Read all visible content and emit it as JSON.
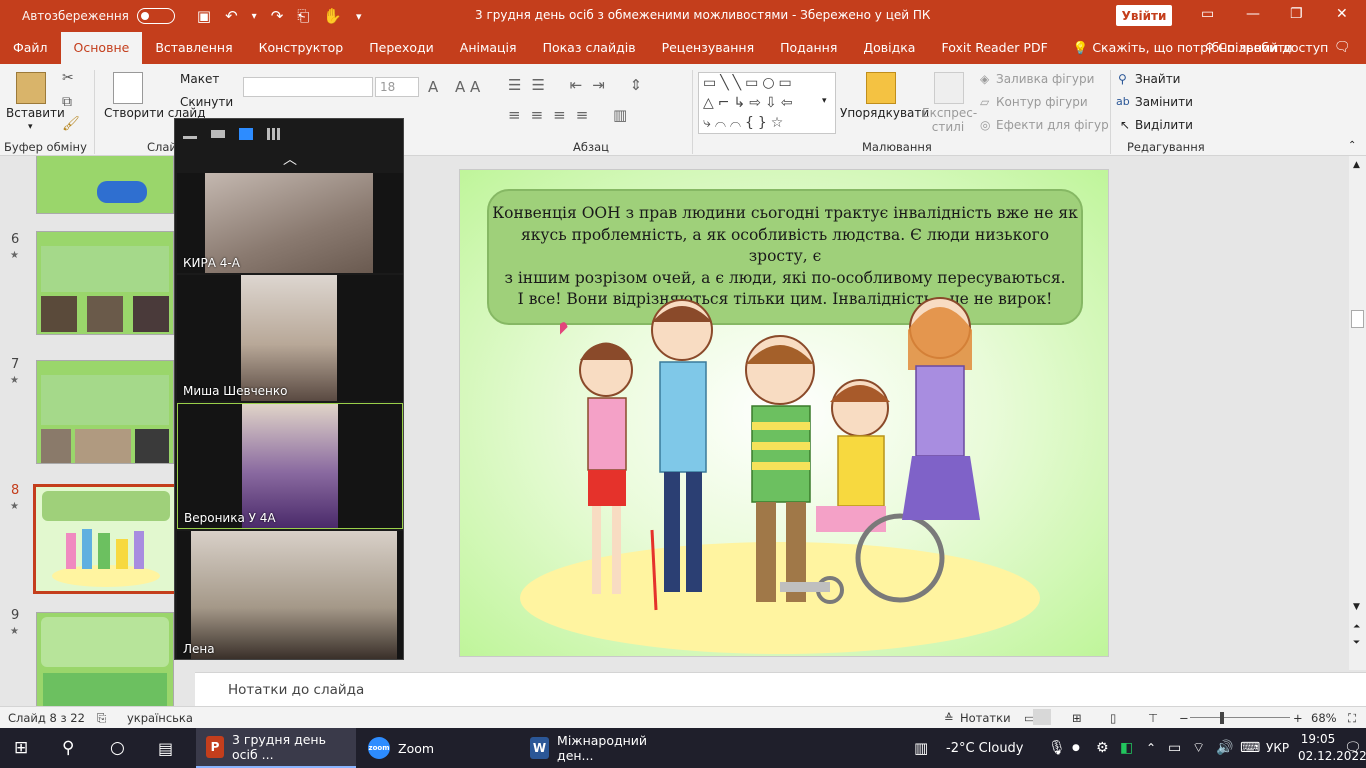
{
  "titlebar": {
    "autosave_label": "Автозбереження",
    "document_title": "3 грудня день осіб з обмеженими можливостями  -  Збережено у цей ПК",
    "login_label": "Увійти"
  },
  "tabs": [
    "Файл",
    "Основне",
    "Вставлення",
    "Конструктор",
    "Переходи",
    "Анімація",
    "Показ слайдів",
    "Рецензування",
    "Подання",
    "Довідка",
    "Foxit Reader PDF"
  ],
  "tell_me": "Скажіть, що потрібно зробити",
  "share": "Спільний доступ",
  "ribbon": {
    "paste": "Вставити",
    "clipboard_group": "Буфер обміну",
    "new_slide": "Створити слайд",
    "layout": "Макет",
    "reset": "Скинути",
    "slides_group": "Слай",
    "font_size": "18",
    "paragraph_group": "Абзац",
    "arrange": "Упорядкувати",
    "quick_styles": "Експрес-стилі",
    "shape_fill": "Заливка фігури",
    "shape_outline": "Контур фігури",
    "shape_effects": "Ефекти для фігур",
    "drawing_group": "Малювання",
    "find": "Знайти",
    "replace": "Замінити",
    "select": "Виділити",
    "editing_group": "Редагування"
  },
  "thumbnails": [
    {
      "number": "6"
    },
    {
      "number": "7"
    },
    {
      "number": "8"
    },
    {
      "number": "9"
    }
  ],
  "zoom": {
    "participants": [
      "КИРА 4-А",
      "Миша Шевченко",
      "Вероника У 4А",
      "Лена"
    ]
  },
  "slide": {
    "text_lines": [
      "Конвенція ООН з прав людини сьогодні трактує інвалідність вже не як",
      "якусь проблемність, а як особливість людства. Є люди низького зросту, є",
      "з іншим розрізом очей, а є люди, які по-особливому пересуваються.",
      "І все! Вони відрізняються тільки цим. Інвалідність – це не вирок!"
    ]
  },
  "notes_placeholder": "Нотатки до слайда",
  "status": {
    "slide_counter": "Слайд 8 з 22",
    "language": "українська",
    "notes_btn": "Нотатки",
    "zoom_level": "68%"
  },
  "taskbar": {
    "ppt_app": "3 грудня день осіб ...",
    "zoom_app": "Zoom",
    "word_app": "Міжнародний ден...",
    "weather": "-2°C  Cloudy",
    "lang": "УКР",
    "time": "19:05",
    "date": "02.12.2022"
  },
  "colors": {
    "accent": "#c43e1c",
    "slide_bubble": "#9fd07a",
    "slide_bg": "#bff59a"
  }
}
